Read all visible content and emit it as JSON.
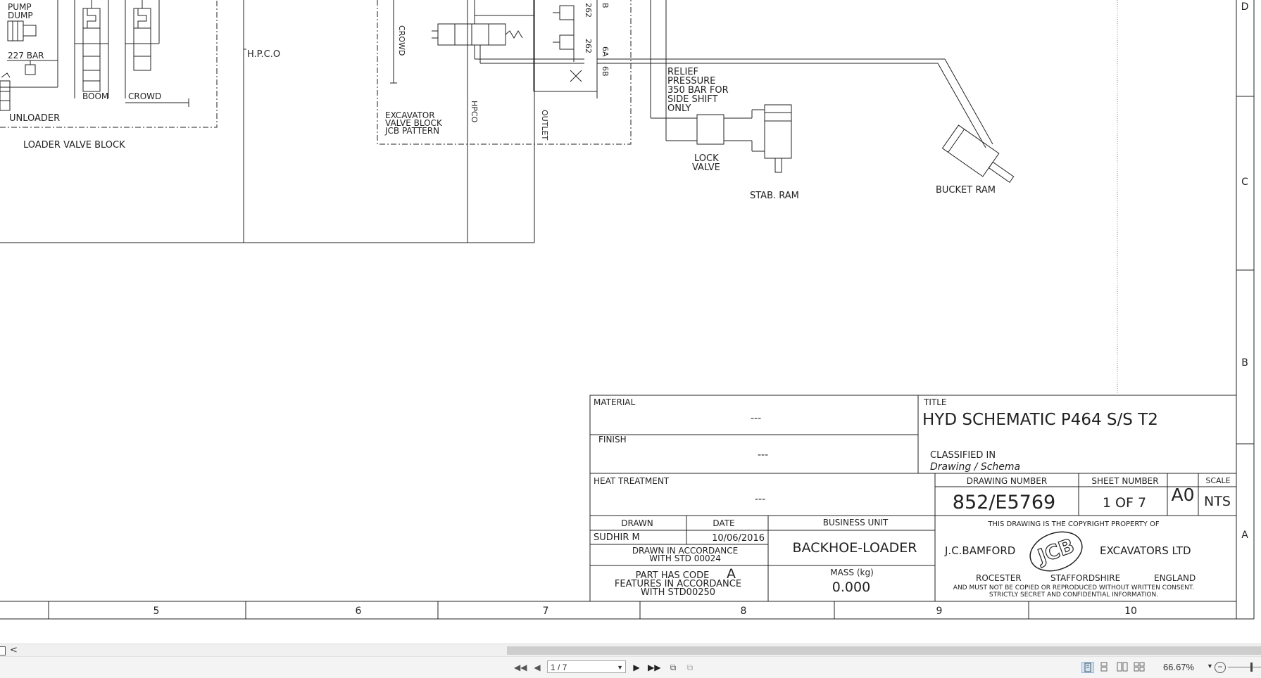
{
  "drawing": {
    "loader": {
      "pump_dump": [
        "PUMP",
        "DUMP"
      ],
      "bar_227": "227 BAR",
      "boom": "BOOM",
      "crowd": "CROWD",
      "unloader": "UNLOADER",
      "loader_valve_block": "LOADER VALVE BLOCK",
      "hpco_top": "H.P.C.O"
    },
    "excavator": {
      "crowd": "CROWD",
      "block_lines": [
        "EXCAVATOR",
        "VALVE BLOCK",
        "JCB PATTERN"
      ],
      "hpco": "HPCO",
      "outlet": "OUTLET",
      "port_262a": "262",
      "port_262b": "262",
      "port_6a": "6A",
      "port_6b": "6B",
      "port_b": "B"
    },
    "relief_lines": [
      "RELIEF",
      "PRESSURE",
      "350 BAR FOR",
      "SIDE SHIFT",
      "ONLY"
    ],
    "lock_valve": [
      "LOCK",
      "VALVE"
    ],
    "stab_ram": "STAB. RAM",
    "bucket_ram": "BUCKET RAM",
    "zones_right": [
      "D",
      "C",
      "B",
      "A"
    ],
    "zones_bottom": [
      "5",
      "6",
      "7",
      "8",
      "9",
      "10"
    ]
  },
  "title_block": {
    "material_label": "MATERIAL",
    "material_value": "---",
    "finish_label": "FINISH",
    "finish_value": "---",
    "heat_label": "HEAT TREATMENT",
    "heat_value": "---",
    "title_label": "TITLE",
    "title_value": "HYD SCHEMATIC P464 S/S T2",
    "classified_label": "CLASSIFIED IN",
    "classified_value": "Drawing / Schema",
    "drawing_number_label": "DRAWING NUMBER",
    "drawing_number": "852/E5769",
    "sheet_label": "SHEET NUMBER",
    "sheet_value": "1 OF 7",
    "size": "A0",
    "scale_label": "SCALE",
    "scale_value": "NTS",
    "drawn_label": "DRAWN",
    "date_label": "DATE",
    "business_unit_label": "BUSINESS UNIT",
    "drawn_by": "SUDHIR M",
    "date": "10/06/2016",
    "business_unit": "BACKHOE-LOADER",
    "drawn_std": [
      "DRAWN IN ACCORDANCE",
      "WITH STD 00024"
    ],
    "part_code_line": "PART HAS CODE",
    "part_code": "A",
    "part_features": [
      "FEATURES IN ACCORDANCE",
      "WITH STD00250"
    ],
    "mass_label": "MASS (kg)",
    "mass_value": "0.000",
    "copyright_line": "THIS DRAWING IS THE COPYRIGHT PROPERTY OF",
    "company_left": "J.C.BAMFORD",
    "company_right": "EXCAVATORS LTD",
    "logo": "JCB",
    "address": [
      "ROCESTER",
      "STAFFORDSHIRE",
      "ENGLAND"
    ],
    "confidential": [
      "AND MUST NOT BE COPIED OR REPRODUCED WITHOUT WRITTEN CONSENT.",
      "STRICTLY SECRET AND CONFIDENTIAL INFORMATION."
    ]
  },
  "viewer": {
    "page_indicator": "1 / 7",
    "zoom": "66.67%",
    "scroll_left_arrow": "<"
  }
}
